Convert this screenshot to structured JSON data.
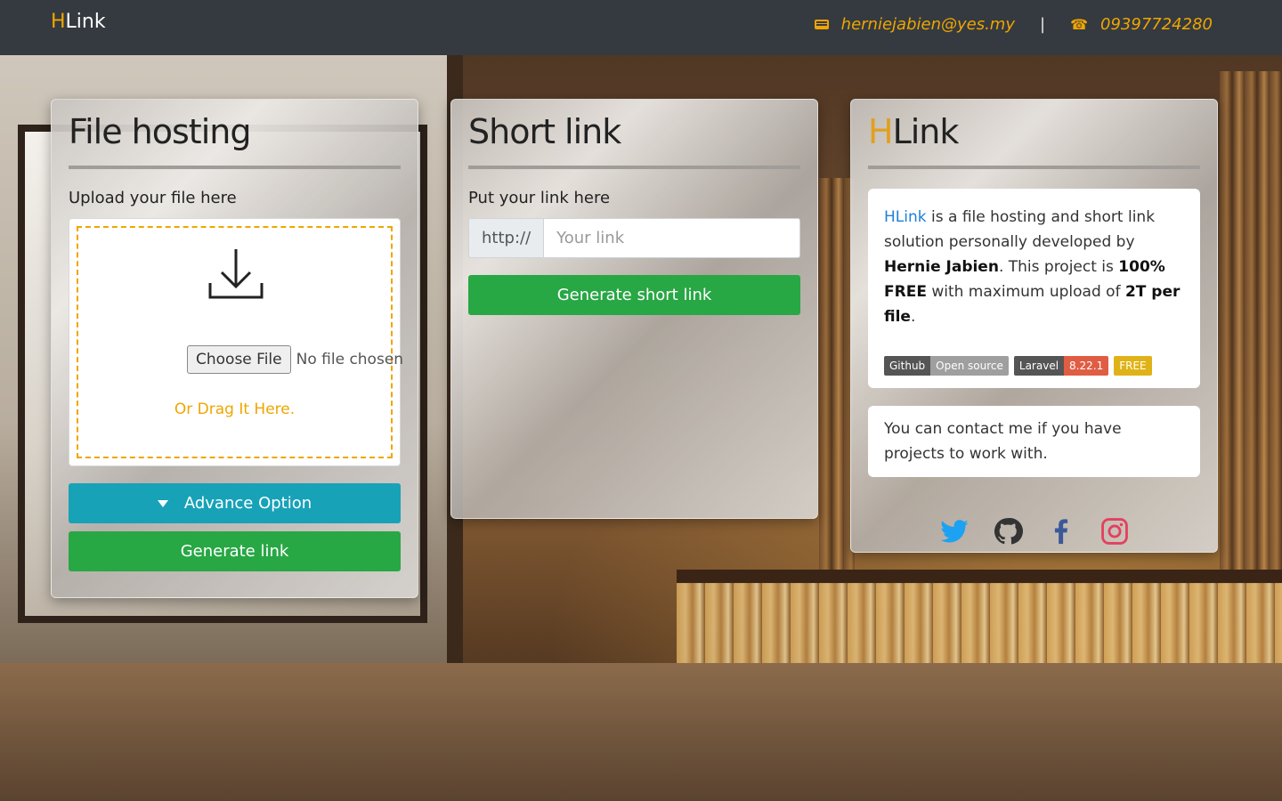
{
  "navbar": {
    "brand_accent": "H",
    "brand_rest": "Link",
    "email": "herniejabien@yes.my",
    "separator": "|",
    "phone": "09397724280"
  },
  "file_card": {
    "title": "File hosting",
    "upload_label": "Upload your file here",
    "choose_file_label": "Choose File",
    "no_file_text": "No file chosen",
    "drag_text": "Or Drag It Here.",
    "advance_option_label": "Advance Option",
    "generate_link_label": "Generate link"
  },
  "short_card": {
    "title": "Short link",
    "link_label": "Put your link here",
    "prefix": "http://",
    "input_placeholder": "Your link",
    "generate_short_label": "Generate short link"
  },
  "about_card": {
    "title_accent": "H",
    "title_rest": "Link",
    "intro": {
      "brand": "HLink",
      "text1": " is a file hosting and short link solution personally developed by ",
      "author": "Hernie Jabien",
      "text2": ". This project is ",
      "free": "100% FREE",
      "text3": " with maximum upload of ",
      "limit": "2T per file",
      "text4": "."
    },
    "badges": [
      {
        "left": "Github",
        "right": "Open source"
      },
      {
        "left": "Laravel",
        "right": "8.22.1"
      },
      {
        "single": "FREE"
      }
    ],
    "contact_text": "You can contact me if you have projects to work with.",
    "socials": [
      "twitter-icon",
      "github-icon",
      "facebook-icon",
      "instagram-icon"
    ],
    "colors": {
      "twitter": "#1da1f2",
      "github": "#333333",
      "facebook": "#3b5998",
      "instagram": "#e4405f",
      "accent": "#f0a500"
    }
  }
}
